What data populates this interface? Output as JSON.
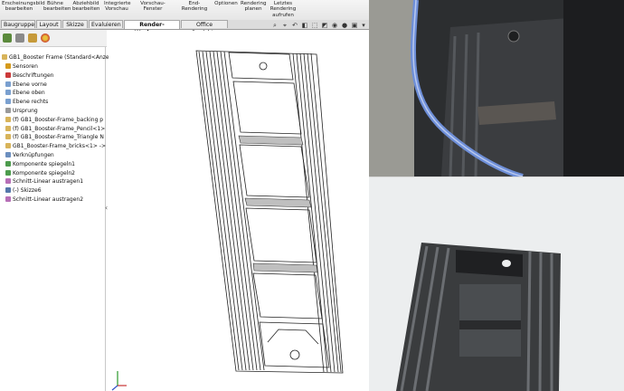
{
  "ribbon": {
    "buttons": [
      "Erscheinungsbild bearbeiten",
      "Bühne bearbeiten",
      "Abziehbild bearbeiten",
      "Integrierte Vorschau",
      "Vorschau-Fenster",
      "End-Rendering",
      "Optionen",
      "Rendering planen",
      "Letztes Rendering aufrufen"
    ]
  },
  "tabs": [
    {
      "label": "Baugruppe",
      "active": false
    },
    {
      "label": "Layout",
      "active": false
    },
    {
      "label": "Skizze",
      "active": false
    },
    {
      "label": "Evaluieren",
      "active": false
    },
    {
      "label": "Render-Werkzeuge",
      "active": true
    },
    {
      "label": "Office Produkte",
      "active": false
    }
  ],
  "feature_tree": {
    "root": "GB1_Booster Frame  (Standard<Anze",
    "items": [
      {
        "label": "Sensoren",
        "icon": "sensor-icon",
        "color": "#d59a1c"
      },
      {
        "label": "Beschriftungen",
        "icon": "annotation-icon",
        "color": "#cc3a3a"
      },
      {
        "label": "Ebene vorne",
        "icon": "plane-icon",
        "color": "#7aa0d0"
      },
      {
        "label": "Ebene oben",
        "icon": "plane-icon",
        "color": "#7aa0d0"
      },
      {
        "label": "Ebene rechts",
        "icon": "plane-icon",
        "color": "#7aa0d0"
      },
      {
        "label": "Ursprung",
        "icon": "origin-icon",
        "color": "#9a9a9a"
      },
      {
        "label": "(f) GB1_Booster-Frame_backing p",
        "icon": "part-icon",
        "color": "#d8b45a"
      },
      {
        "label": "(f) GB1_Booster-Frame_Pencil<1>",
        "icon": "part-icon",
        "color": "#d8b45a"
      },
      {
        "label": "(f) GB1_Booster-Frame_Triangle N",
        "icon": "part-icon",
        "color": "#d8b45a"
      },
      {
        "label": "GB1_Booster-Frame_bricks<1> ->",
        "icon": "part-icon",
        "color": "#d8b45a"
      },
      {
        "label": "Verknüpfungen",
        "icon": "mates-icon",
        "color": "#6c8fbf"
      },
      {
        "label": "Komponente spiegeln1",
        "icon": "mirror-icon",
        "color": "#4d9c4d"
      },
      {
        "label": "Komponente spiegeln2",
        "icon": "mirror-icon",
        "color": "#4d9c4d"
      },
      {
        "label": "Schnitt-Linear austragen1",
        "icon": "cut-icon",
        "color": "#b76fb7"
      },
      {
        "label": "(-) Skizze6",
        "icon": "sketch-icon",
        "color": "#5577aa"
      },
      {
        "label": "Schnitt-Linear austragen2",
        "icon": "cut-icon",
        "color": "#b76fb7"
      }
    ]
  }
}
